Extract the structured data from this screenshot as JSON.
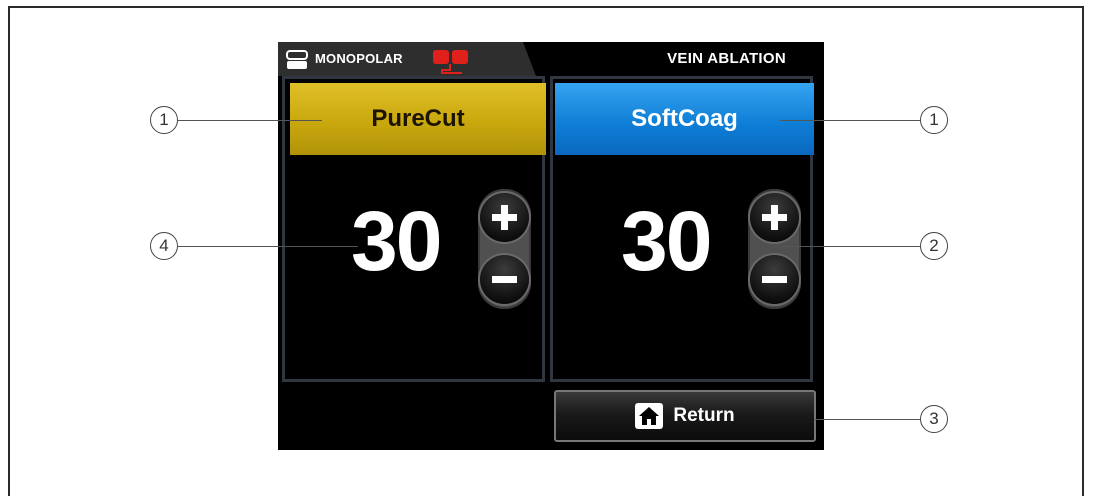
{
  "header": {
    "mode_label": "MONOPOLAR",
    "procedure_label": "VEIN ABLATION",
    "mode_icon": "mode-icon",
    "pedal_icon": "foot-pedal-icon",
    "pedal_color": "#e0201a"
  },
  "panels": [
    {
      "mode_label": "PureCut",
      "value": "30",
      "color": "#c9a80e",
      "plus_icon": "plus-icon",
      "minus_icon": "minus-icon"
    },
    {
      "mode_label": "SoftCoag",
      "value": "30",
      "color": "#0f7fd7",
      "plus_icon": "plus-icon",
      "minus_icon": "minus-icon"
    }
  ],
  "return_button": {
    "label": "Return",
    "icon": "home-icon"
  },
  "callouts": [
    "1",
    "1",
    "4",
    "2",
    "3"
  ]
}
